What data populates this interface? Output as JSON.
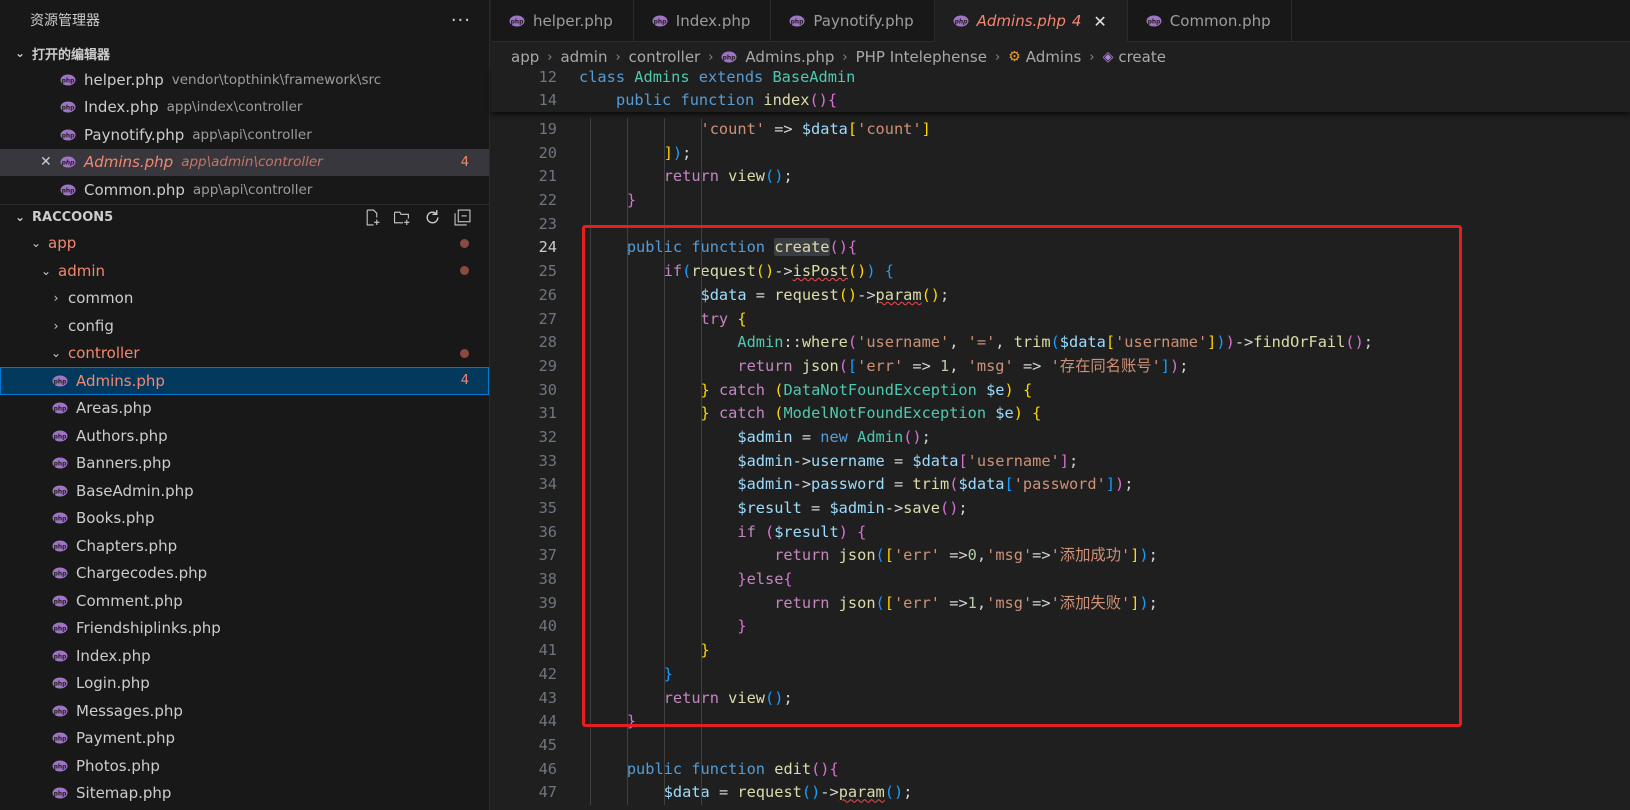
{
  "explorer": {
    "title": "资源管理器",
    "more_label": "···",
    "open_editors": {
      "label": "打开的编辑器",
      "items": [
        {
          "name": "helper.php",
          "path": "vendor\\topthink\\framework\\src",
          "badge": ""
        },
        {
          "name": "Index.php",
          "path": "app\\index\\controller",
          "badge": ""
        },
        {
          "name": "Paynotify.php",
          "path": "app\\api\\controller",
          "badge": ""
        },
        {
          "name": "Admins.php",
          "path": "app\\admin\\controller",
          "badge": "4"
        },
        {
          "name": "Common.php",
          "path": "app\\api\\controller",
          "badge": ""
        }
      ]
    },
    "project": {
      "label": "RACCOON5",
      "folders": {
        "app": "app",
        "admin": "admin",
        "common": "common",
        "config": "config",
        "controller": "controller"
      },
      "files": [
        "Admins.php",
        "Areas.php",
        "Authors.php",
        "Banners.php",
        "BaseAdmin.php",
        "Books.php",
        "Chapters.php",
        "Chargecodes.php",
        "Comment.php",
        "Friendshiplinks.php",
        "Index.php",
        "Login.php",
        "Messages.php",
        "Payment.php",
        "Photos.php",
        "Sitemap.php"
      ],
      "admins_badge": "4"
    }
  },
  "tabs": [
    {
      "label": "helper.php",
      "badge": ""
    },
    {
      "label": "Index.php",
      "badge": ""
    },
    {
      "label": "Paynotify.php",
      "badge": ""
    },
    {
      "label": "Admins.php",
      "badge": "4"
    },
    {
      "label": "Common.php",
      "badge": ""
    }
  ],
  "tab_close_glyph": "✕",
  "breadcrumb": [
    "app",
    "admin",
    "controller",
    "Admins.php",
    "PHP Intelephense",
    "Admins",
    "create"
  ],
  "code": {
    "sticky_line_numbers": [
      "12",
      "14"
    ],
    "line_numbers": [
      "19",
      "20",
      "21",
      "22",
      "23",
      "24",
      "25",
      "26",
      "27",
      "28",
      "29",
      "30",
      "31",
      "32",
      "33",
      "34",
      "35",
      "36",
      "37",
      "38",
      "39",
      "40",
      "41",
      "42",
      "43",
      "44",
      "45",
      "46",
      "47"
    ],
    "strings": {
      "count": "'count'",
      "username": "'username'",
      "eq": "'='",
      "err": "'err'",
      "msg": "'msg'",
      "dup": "'存在同名账号'",
      "password": "'password'",
      "ok": "'添加成功'",
      "fail": "'添加失败'"
    }
  },
  "colors": {
    "accent": "#0078d4",
    "modified": "#f48771",
    "highlight_box": "#e51f1f"
  }
}
